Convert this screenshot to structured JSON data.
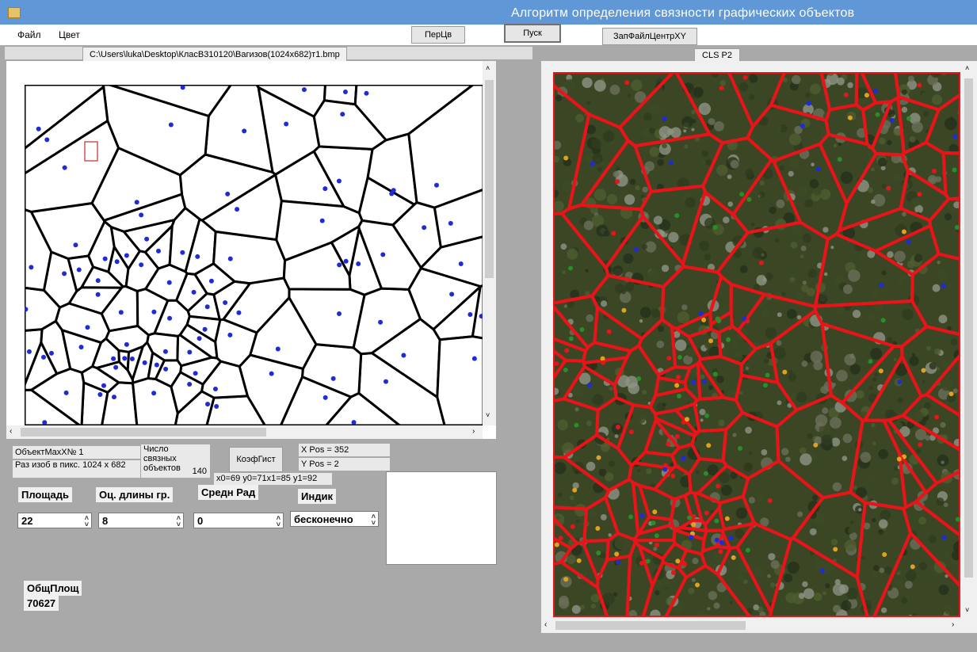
{
  "window": {
    "title": "Алгоритм определения связности графических объектов"
  },
  "menu": {
    "file": "Файл",
    "color": "Цвет"
  },
  "toolbar": {
    "percv": "ПерЦв",
    "start": "Пуск",
    "save_center": "ЗапФайлЦентрXY"
  },
  "left_tab": {
    "path": "C:\\Users\\luka\\Desktop\\КласВ310120\\Вагизов(1024х682)т1.bmp"
  },
  "right_tab": {
    "label": "CLS  P2"
  },
  "info": {
    "object_max": "ОбъектMaxX№ 1",
    "image_size": "Раз изоб в пикс. 1024 x 682",
    "connected_label": "Число связных объектов",
    "connected_count": "140",
    "coef_button": "КоэфГист",
    "xpos": "X Pos = 352",
    "ypos": "Y Pos = 2",
    "coords": "x0=69 y0=71x1=85 y1=92"
  },
  "params": {
    "area_label": "Площадь",
    "border_len_label": "Оц. длины гр.",
    "mean_rad_label": "Средн Рад",
    "indik_label": "Индик",
    "area_value": "22",
    "border_len_value": "8",
    "mean_rad_value": "0",
    "indik_value": "бесконечно"
  },
  "total": {
    "label": "ОбщПлощ",
    "value": "70627"
  },
  "colors": {
    "title_bar": "#5f97d7",
    "cell_edge_left": "#000000",
    "cell_edge_right": "#e8141a",
    "dot": "#1f2bd6"
  }
}
